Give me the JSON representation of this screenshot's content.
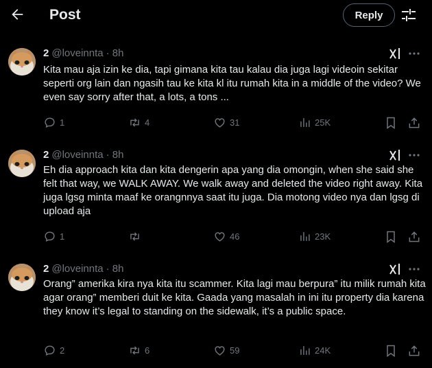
{
  "header": {
    "back_icon": "arrow-left-icon",
    "title": "Post",
    "reply_label": "Reply",
    "settings_icon": "sliders-icon"
  },
  "posts": [
    {
      "name": "2",
      "handle": "@loveinnta",
      "time": "· 8h",
      "text": "Kita mau aja izin ke dia, tapi gimana kita tau kalau dia juga lagi videoin sekitar seperti org lain dan ngasih tau ke kita kl itu rumah kita in a middle of the video? We even say sorry after that, a lots, a tons ...",
      "replies": "1",
      "reposts": "4",
      "likes": "31",
      "views": "25K"
    },
    {
      "name": "2",
      "handle": "@loveinnta",
      "time": "· 8h",
      "text": "Eh dia approach kita dan kita dengerin apa yang dia omongin, when she said she felt that way, we WALK AWAY. We walk away and deleted the video right away. Kita juga lgsg minta maaf ke orangnnya saat itu juga. Dia motong video nya dan lgsg di upload aja",
      "replies": "1",
      "reposts": "",
      "likes": "46",
      "views": "23K"
    },
    {
      "name": "2",
      "handle": "@loveinnta",
      "time": "· 8h",
      "text": "Orang” amerika kira nya kita itu scammer. Kita lagi mau berpura” itu milik rumah kita agar orang” memberi duit ke kita. Gaada yang masalah in ini itu property dia karena they know it’s legal to standing on the sidewalk, it’s a public space.",
      "replies": "2",
      "reposts": "6",
      "likes": "59",
      "views": "24K"
    }
  ]
}
